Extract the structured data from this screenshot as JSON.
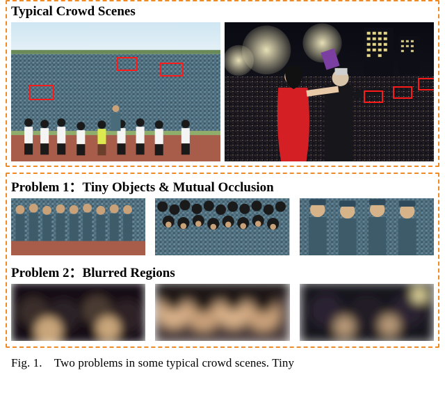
{
  "figure": {
    "topTitle": "Typical Crowd Scenes",
    "problem1Title": "Problem 1：Tiny Objects & Mutual Occlusion",
    "problem2Title": "Problem 2：Blurred Regions",
    "captionPrefix": "Fig. 1.",
    "captionText": "Two problems in some typical crowd scenes. Tiny"
  }
}
